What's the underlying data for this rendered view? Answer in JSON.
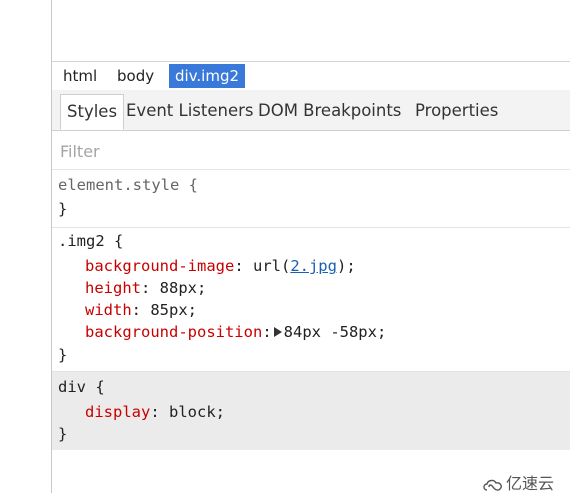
{
  "breadcrumb": [
    {
      "label": "html"
    },
    {
      "label": "body"
    },
    {
      "label": "div.img2",
      "active": true
    }
  ],
  "tabs": [
    {
      "label": "Styles",
      "active": true
    },
    {
      "label": "Event Listeners"
    },
    {
      "label": "DOM Breakpoints"
    },
    {
      "label": "Properties"
    }
  ],
  "filter": {
    "placeholder": "Filter"
  },
  "rules": {
    "element_style": {
      "selector": "element.style {",
      "close": "}"
    },
    "img2": {
      "selector": ".img2 {",
      "declarations": [
        {
          "prop": "background-image",
          "value_pre": "url(",
          "link": "2.jpg",
          "value_post": ");"
        },
        {
          "prop": "height",
          "value": "88px;"
        },
        {
          "prop": "width",
          "value": "85px;"
        },
        {
          "prop": "background-position",
          "value": "84px -58px;"
        }
      ],
      "close": "}"
    },
    "div": {
      "selector": "div {",
      "declarations": [
        {
          "prop": "display",
          "value": "block;"
        }
      ],
      "close": "}"
    }
  },
  "watermark": {
    "text": "亿速云"
  },
  "colors": {
    "active_crumb": "#3879d9",
    "property": "#c80000",
    "link": "#1a5fb4"
  }
}
